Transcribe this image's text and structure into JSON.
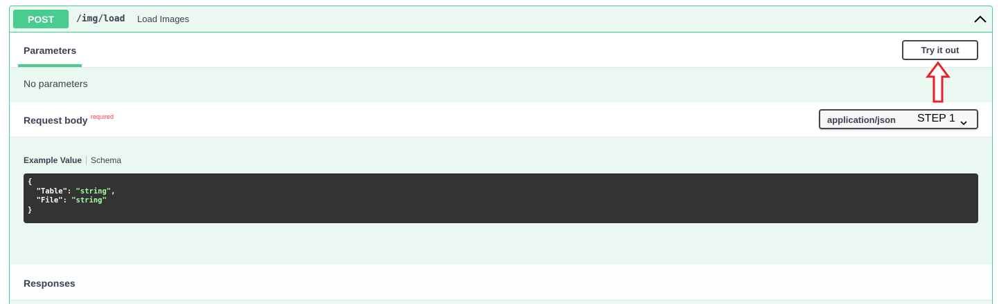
{
  "operation": {
    "method": "POST",
    "path": "/img/load",
    "description": "Load Images"
  },
  "parameters": {
    "tab_label": "Parameters",
    "try_button": "Try it out",
    "empty_text": "No parameters"
  },
  "request_body": {
    "label": "Request body",
    "required_label": "required",
    "content_type": "application/json",
    "step_annotation": "STEP 1",
    "example_tab": "Example Value",
    "schema_tab": "Schema",
    "example": {
      "open_brace": "{",
      "line1_key": "  \"Table\": ",
      "line1_value": "\"string\"",
      "line1_comma": ",",
      "line2_key": "  \"File\": ",
      "line2_value": "\"string\"",
      "close_brace": "}"
    }
  },
  "responses": {
    "label": "Responses"
  },
  "colors": {
    "post_green": "#49cc90",
    "annotation_red": "#e8202a",
    "code_background": "#333333"
  },
  "icons": {
    "collapse": "chevron-up-icon",
    "select": "chevron-down-icon",
    "annotation": "up-arrow-icon"
  }
}
